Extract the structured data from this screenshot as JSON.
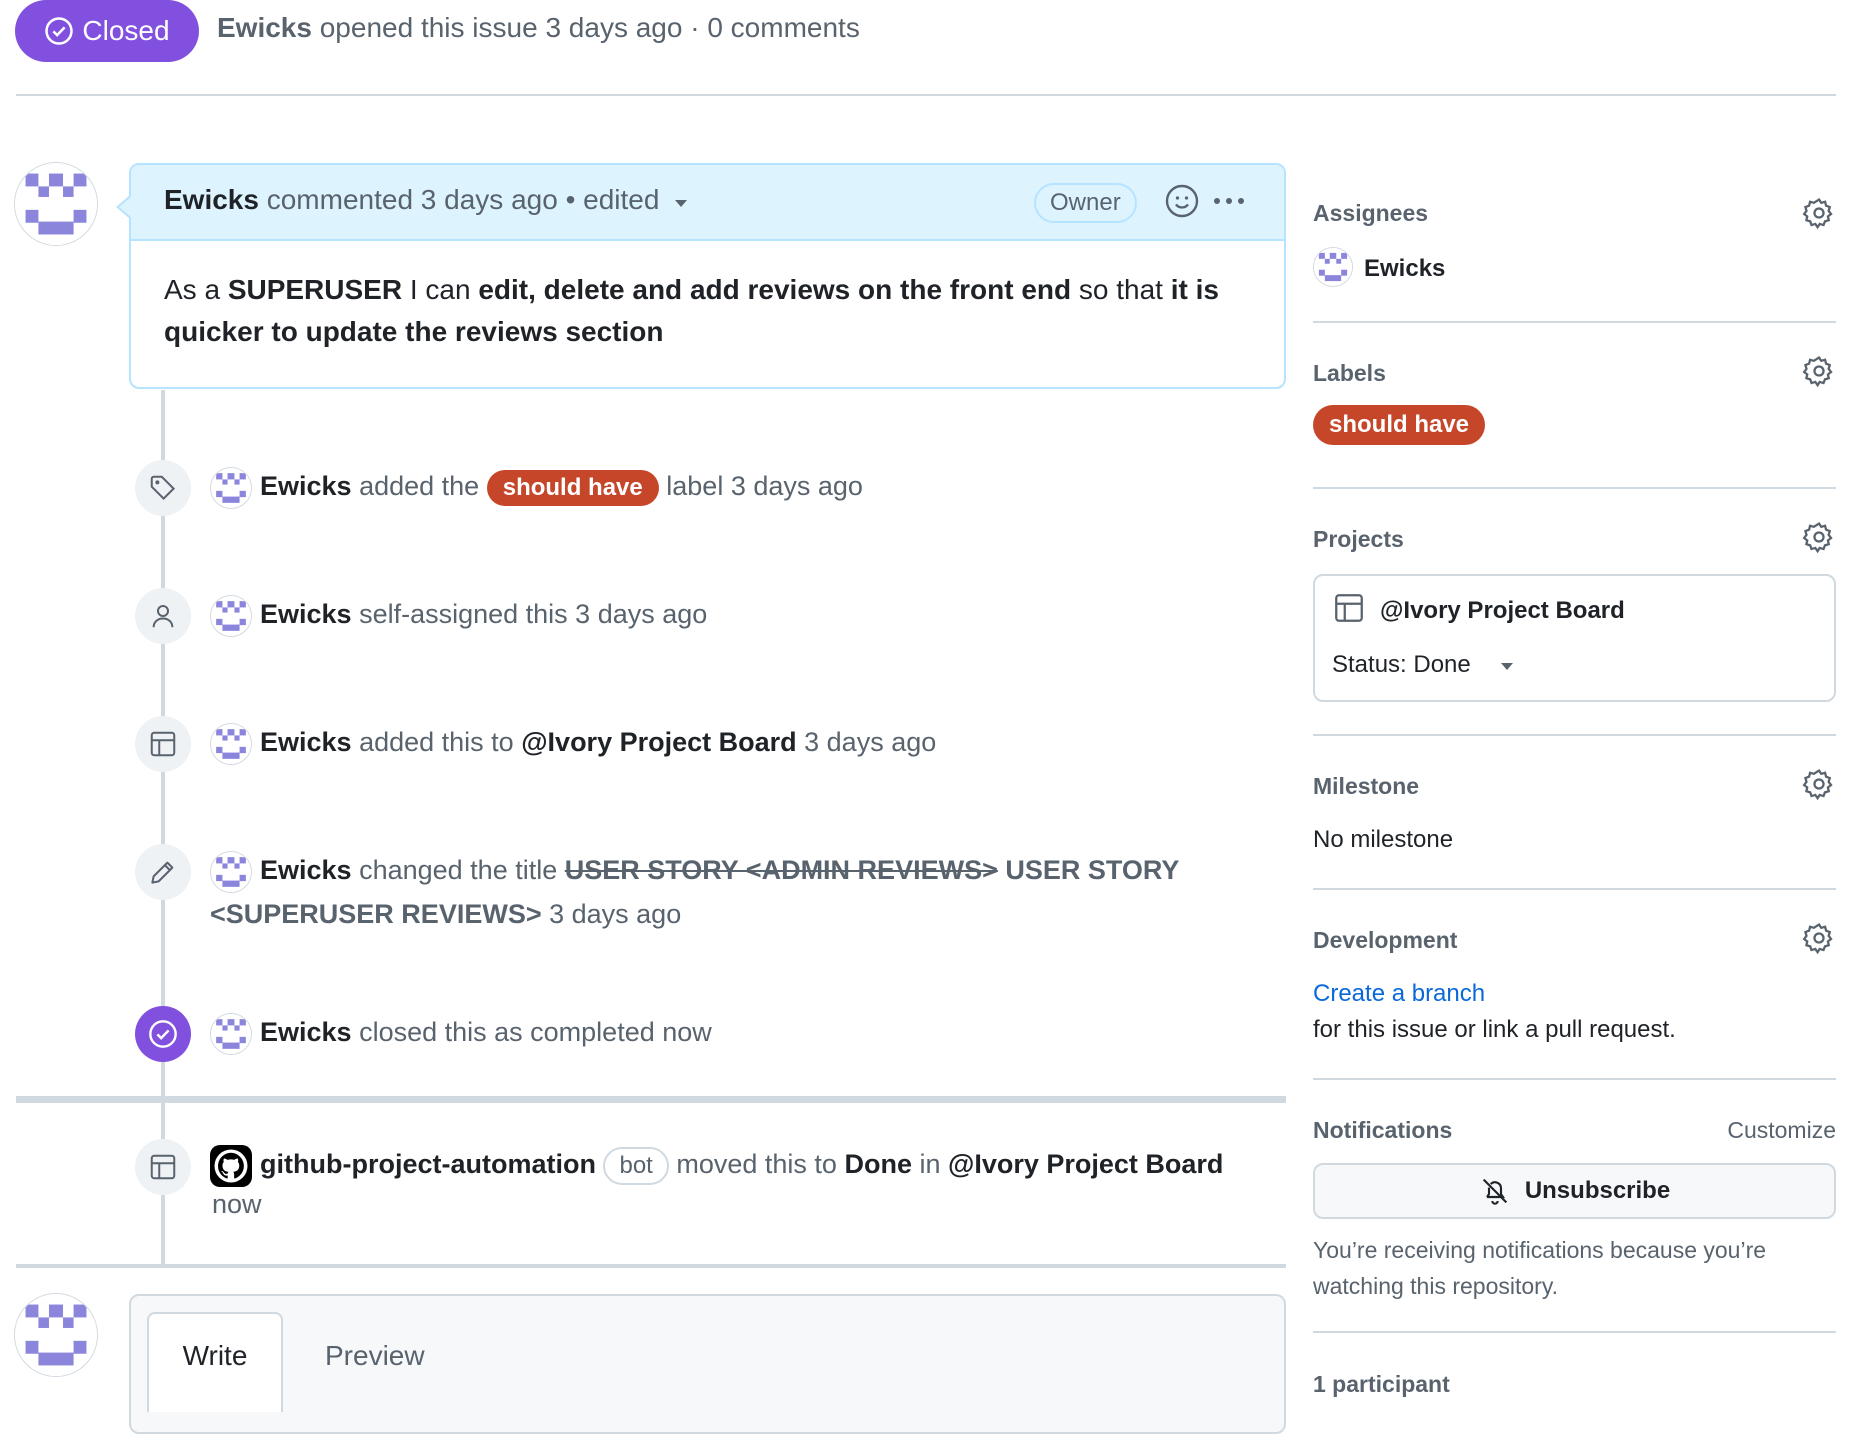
{
  "header": {
    "state_label": "Closed",
    "author": "Ewicks",
    "summary": "opened this issue 3 days ago · 0 comments"
  },
  "comment": {
    "author": "Ewicks",
    "meta": "commented 3 days ago",
    "edited": "• edited",
    "role_badge": "Owner",
    "body": {
      "p1": "As a ",
      "b1": "SUPERUSER",
      "p2": " I can ",
      "b2": "edit, delete and add reviews on the front end",
      "p3": " so that ",
      "b3": "it is quicker to update the reviews section"
    }
  },
  "timeline": {
    "label_event": {
      "author": "Ewicks",
      "pre": "added the",
      "label": "should have",
      "post": "label 3 days ago"
    },
    "assign_event": {
      "author": "Ewicks",
      "text": "self-assigned this 3 days ago"
    },
    "project_event": {
      "author": "Ewicks",
      "pre": "added this to",
      "project": "@Ivory Project Board",
      "post": "3 days ago"
    },
    "title_event": {
      "author": "Ewicks",
      "pre": "changed the title",
      "old_title": "USER STORY <ADMIN REVIEWS>",
      "new_title": "USER STORY <SUPERUSER REVIEWS>",
      "post": "3 days ago"
    },
    "close_event": {
      "author": "Ewicks",
      "text": "closed this as completed now"
    },
    "bot_event": {
      "author": "github-project-automation",
      "badge": "bot",
      "pre": "moved this to",
      "status": "Done",
      "mid": "in",
      "project": "@Ivory Project Board",
      "post": "now"
    }
  },
  "composer": {
    "tab_write": "Write",
    "tab_preview": "Preview"
  },
  "sidebar": {
    "assignees": {
      "title": "Assignees",
      "user": "Ewicks"
    },
    "labels": {
      "title": "Labels",
      "label": "should have",
      "label_color": "#c6462a"
    },
    "projects": {
      "title": "Projects",
      "project": "@Ivory Project Board",
      "status": "Status: Done"
    },
    "milestone": {
      "title": "Milestone",
      "value": "No milestone"
    },
    "development": {
      "title": "Development",
      "link": "Create a branch",
      "text": "for this issue or link a pull request."
    },
    "notifications": {
      "title": "Notifications",
      "customize": "Customize",
      "button": "Unsubscribe",
      "text": "You’re receiving notifications because you’re watching this repository."
    },
    "participants": {
      "title": "1 participant"
    }
  },
  "colors": {
    "closed_purple": "#8250df",
    "link_blue": "#0969da",
    "comment_header": "#ddf4ff"
  },
  "icons": [
    "check-circle-icon",
    "smiley-icon",
    "kebab-icon",
    "tag-icon",
    "person-icon",
    "table-icon",
    "pencil-icon",
    "github-icon",
    "gear-icon",
    "bell-slash-icon",
    "triangle-down-icon"
  ]
}
